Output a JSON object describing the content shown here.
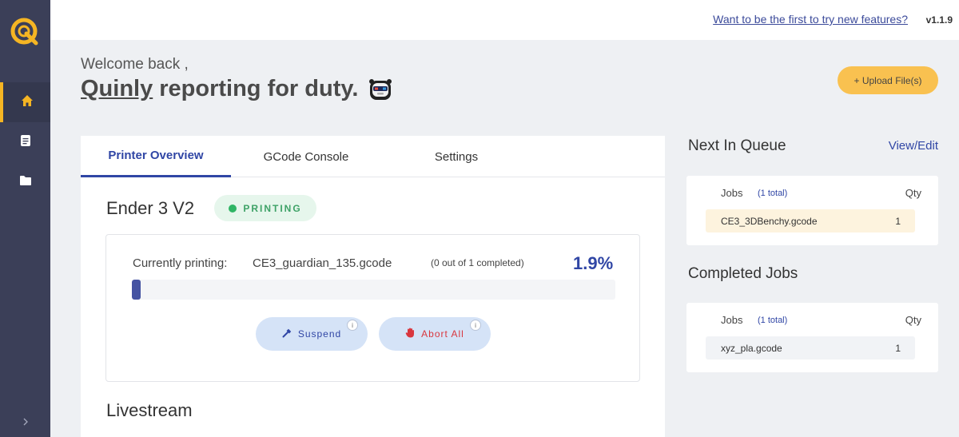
{
  "topbar": {
    "feature_link": "Want to be the first to try new features?",
    "version": "v1.1.9"
  },
  "welcome": {
    "greeting": "Welcome back ,",
    "name": "Quinly",
    "tagline_rest": "reporting for duty."
  },
  "upload_button": "+ Upload File(s)",
  "tabs": [
    {
      "label": "Printer Overview",
      "active": true
    },
    {
      "label": "GCode Console",
      "active": false
    },
    {
      "label": "Settings",
      "active": false
    }
  ],
  "printer": {
    "name": "Ender 3 V2",
    "status": "PRINTING",
    "status_color": "#2fb565",
    "currently_printing_label": "Currently printing:",
    "file": "CE3_guardian_135.gcode",
    "completed_text": "(0 out of 1 completed)",
    "progress_text": "1.9%",
    "progress_fraction": 0.019,
    "suspend_label": "Suspend",
    "abort_label": "Abort All",
    "info_glyph": "i"
  },
  "livestream_title": "Livestream",
  "queue": {
    "title": "Next In Queue",
    "view_edit": "View/Edit",
    "jobs_label": "Jobs",
    "total": "(1 total)",
    "qty_label": "Qty",
    "items": [
      {
        "file": "CE3_3DBenchy.gcode",
        "qty": "1"
      }
    ]
  },
  "completed": {
    "title": "Completed Jobs",
    "jobs_label": "Jobs",
    "total": "(1 total)",
    "qty_label": "Qty",
    "items": [
      {
        "file": "xyz_pla.gcode",
        "qty": "1"
      }
    ]
  },
  "colors": {
    "sidebar": "#3b3f58",
    "accent": "#f5b523",
    "primary": "#3046a5"
  },
  "icons": [
    "logo-icon",
    "home-icon",
    "document-icon",
    "folder-icon",
    "chevron-right-icon",
    "robot-icon",
    "hammer-icon",
    "hand-stop-icon"
  ]
}
